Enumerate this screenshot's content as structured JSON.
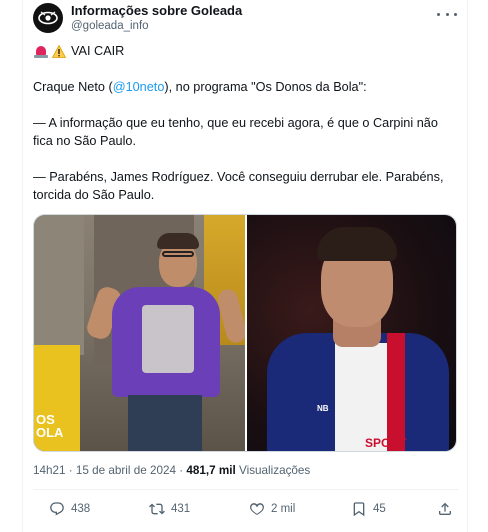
{
  "author": {
    "display_name": "Informações sobre Goleada",
    "handle": "@goleada_info",
    "avatar_icon": "eye-logo-icon"
  },
  "tweet": {
    "headline": "VAI CAIR",
    "emojis": [
      "siren-icon",
      "warning-icon"
    ],
    "intro_before": "Craque Neto (",
    "intro_mention": "@10neto",
    "intro_after": "), no programa \"Os Donos da Bola\":",
    "quote1": "— A informação que eu tenho, que eu recebi agora, é que o Carpini não fica no São Paulo.",
    "quote2": "— Parabéns, James Rodríguez. Você conseguiu derrubar ele. Parabéns, torcida do São Paulo."
  },
  "media": {
    "left_overlay_text": "OS\nOLA",
    "right_jersey_text": "SPORT"
  },
  "meta": {
    "time": "14h21",
    "sep1": " · ",
    "date": "15 de abril de 2024",
    "sep2": " · ",
    "views_count": "481,7 mil",
    "views_label": " Visualizações"
  },
  "actions": {
    "replies": "438",
    "reposts": "431",
    "likes": "2 mil",
    "bookmarks": "45"
  },
  "colors": {
    "accent": "#1d9bf0",
    "text": "#0f1419",
    "muted": "#536471"
  }
}
